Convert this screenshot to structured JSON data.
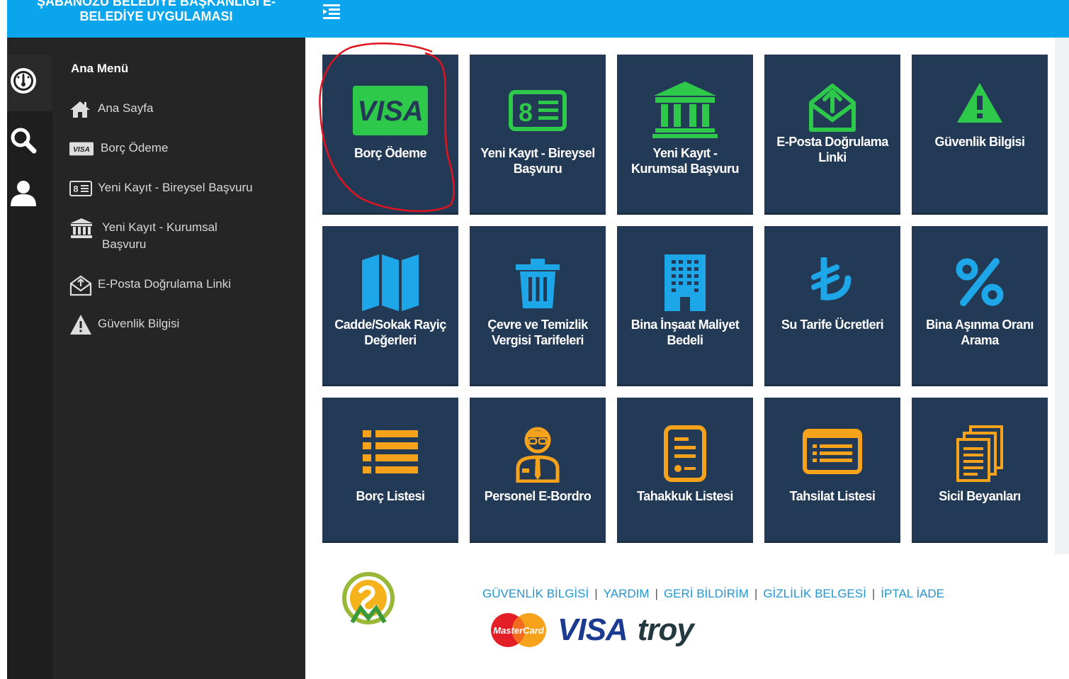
{
  "header": {
    "brand_line1": "ŞABANÖZÜ BELEDİYE BAŞKANLIĞI E-",
    "brand_line2": "BELEDİYE UYGULAMASI",
    "bg_color": "#0aa5ec"
  },
  "iconbar": {
    "icons": [
      "dashboard-icon",
      "search-icon",
      "user-icon"
    ]
  },
  "sidebar": {
    "title": "Ana Menü",
    "items": [
      {
        "label": "Ana Sayfa",
        "icon": "home-icon"
      },
      {
        "label": "Borç Ödeme",
        "icon": "visa-icon"
      },
      {
        "label": "Yeni Kayıt - Bireysel Başvuru",
        "icon": "id-card-icon"
      },
      {
        "label": "Yeni Kayıt - Kurumsal Başvuru",
        "icon": "bank-icon"
      },
      {
        "label": "E-Posta Doğrulama Linki",
        "icon": "envelope-open-icon"
      },
      {
        "label": "Güvenlik Bilgisi",
        "icon": "warning-icon"
      }
    ]
  },
  "tiles": [
    {
      "label": "Borç Ödeme",
      "icon": "visa-icon",
      "color": "#2ec84a"
    },
    {
      "label": "Yeni Kayıt - Bireysel Başvuru",
      "icon": "id-card-icon",
      "color": "#2ec84a"
    },
    {
      "label": "Yeni Kayıt - Kurumsal Başvuru",
      "icon": "bank-icon",
      "color": "#2ec84a"
    },
    {
      "label": "E-Posta Doğrulama Linki",
      "icon": "envelope-open-icon",
      "color": "#2ec84a"
    },
    {
      "label": "Güvenlik Bilgisi",
      "icon": "warning-icon",
      "color": "#2ec84a"
    },
    {
      "label": "Cadde/Sokak Rayiç Değerleri",
      "icon": "map-icon",
      "color": "#1ea7e8"
    },
    {
      "label": "Çevre ve Temizlik Vergisi Tarifeleri",
      "icon": "trash-icon",
      "color": "#1ea7e8"
    },
    {
      "label": "Bina İnşaat Maliyet Bedeli",
      "icon": "building-icon",
      "color": "#1ea7e8"
    },
    {
      "label": "Su Tarife Ücretleri",
      "icon": "lira-icon",
      "color": "#1ea7e8"
    },
    {
      "label": "Bina Aşınma Oranı Arama",
      "icon": "percent-icon",
      "color": "#1ea7e8"
    },
    {
      "label": "Borç Listesi",
      "icon": "list-icon",
      "color": "#f7a21b"
    },
    {
      "label": "Personel E-Bordro",
      "icon": "employee-icon",
      "color": "#f7a21b"
    },
    {
      "label": "Tahakkuk Listesi",
      "icon": "document-icon",
      "color": "#f7a21b"
    },
    {
      "label": "Tahsilat Listesi",
      "icon": "receipt-list-icon",
      "color": "#f7a21b"
    },
    {
      "label": "Sicil Beyanları",
      "icon": "files-icon",
      "color": "#f7a21b"
    }
  ],
  "footer": {
    "links": [
      "GÜVENLİK BİLGİSİ",
      "YARDIM",
      "GERİ BİLDİRİM",
      "GİZLİLİK BELGESİ",
      "İPTAL İADE"
    ],
    "cards": {
      "mastercard": "MasterCard",
      "visa": "VISA",
      "troy": "troy"
    }
  },
  "colors": {
    "tile_bg": "#233a57",
    "sidebar_bg": "#252525",
    "link_color": "#2196d3",
    "annotation": "#e0141e"
  }
}
